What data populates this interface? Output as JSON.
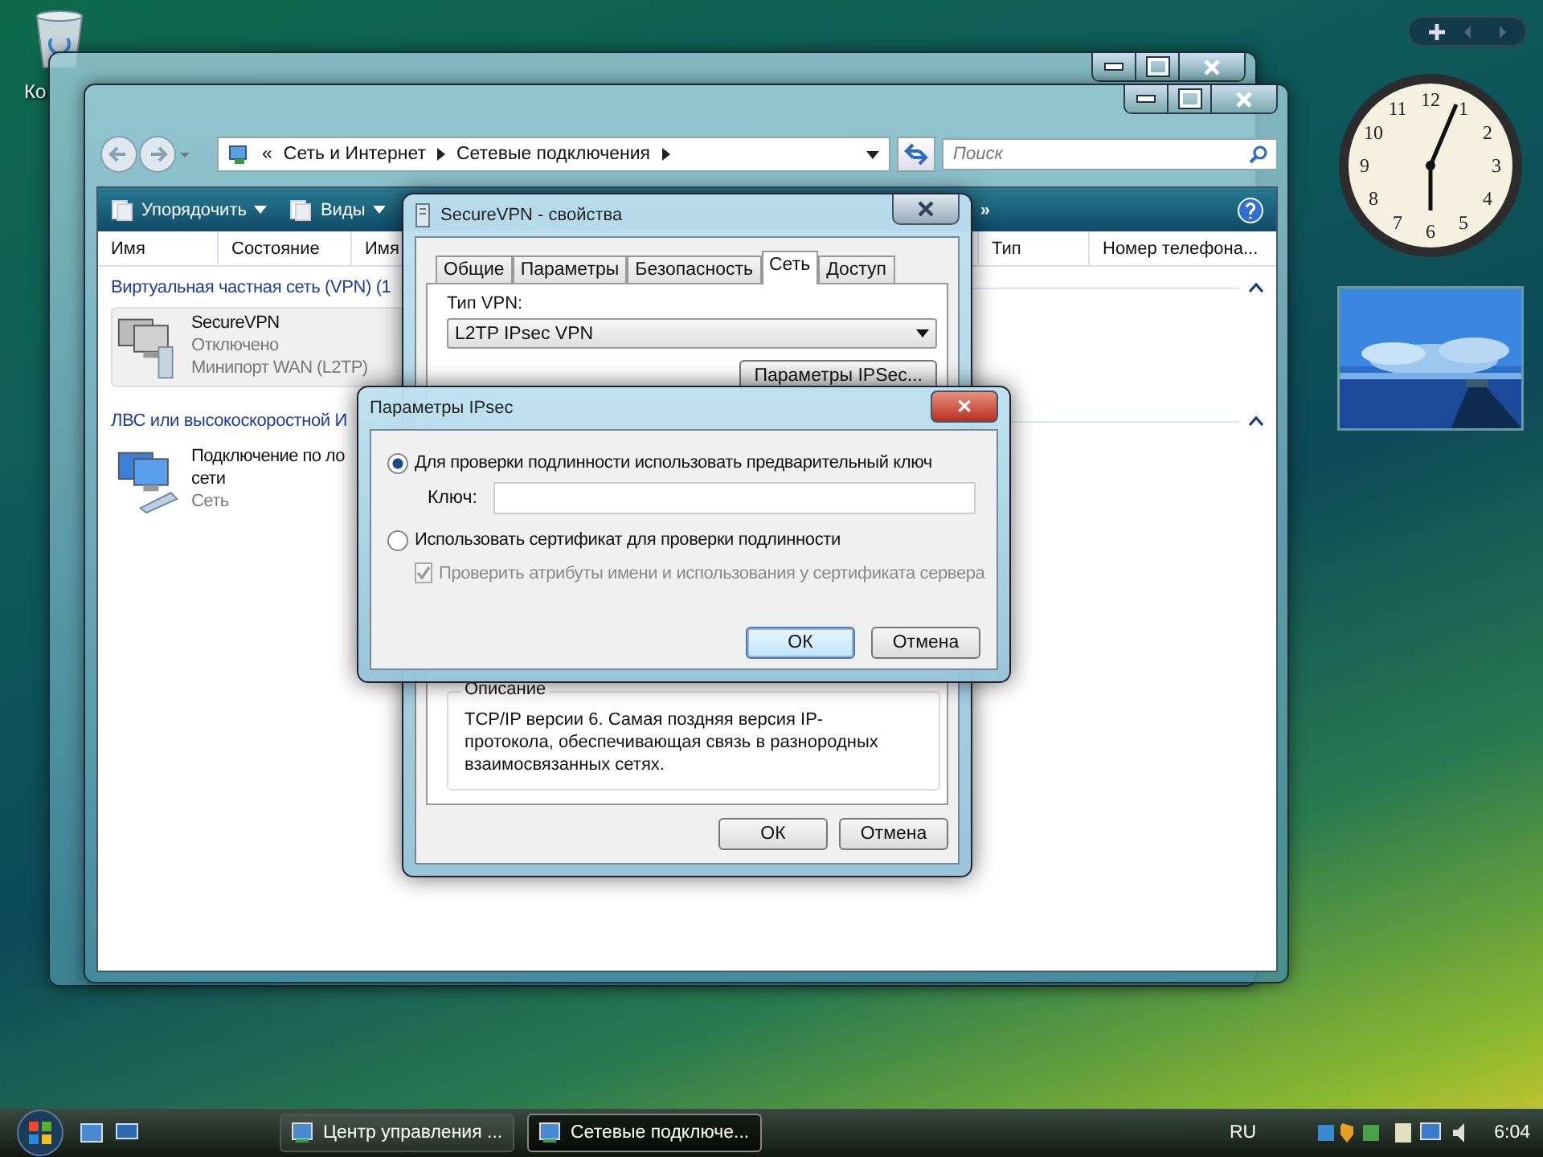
{
  "desktop": {
    "icons": [
      {
        "label": "Ко"
      }
    ]
  },
  "explorer": {
    "breadcrumb": [
      "«",
      "Сеть и Интернет",
      "Сетевые подключения"
    ],
    "search": {
      "placeholder": "Поиск"
    },
    "toolbar": [
      {
        "label": "Упорядочить"
      },
      {
        "label": "Виды"
      }
    ],
    "toolbar_overflow": "»",
    "columns_left": [
      "Имя",
      "Состояние",
      "Имя"
    ],
    "columns_right": [
      "Тип",
      "Номер телефона..."
    ],
    "groups": [
      {
        "title": "Виртуальная частная сеть (VPN) (1",
        "items": [
          {
            "lines": [
              "SecureVPN",
              "Отключено",
              "Минипорт WAN (L2TP)"
            ],
            "connected": false,
            "selected": true
          }
        ]
      },
      {
        "title": "ЛВС или высокоскоростной И",
        "items": [
          {
            "lines": [
              "Подключение по ло",
              "сети",
              "Сеть"
            ],
            "connected": true,
            "selected": false
          }
        ]
      }
    ]
  },
  "properties_dialog": {
    "title": "SecureVPN - свойства",
    "tabs": [
      {
        "label": "Общие",
        "selected": false
      },
      {
        "label": "Параметры",
        "selected": false
      },
      {
        "label": "Безопасность",
        "selected": false
      },
      {
        "label": "Сеть",
        "selected": true
      },
      {
        "label": "Доступ",
        "selected": false
      }
    ],
    "vpn_type_label": "Тип VPN:",
    "vpn_type_value": "L2TP IPsec VPN",
    "ipsec_button": "Параметры IPSec...",
    "description_label": "Описание",
    "description": "TCP/IP версии 6. Самая поздняя версия IP-протокола, обеспечивающая связь в разнородных взаимосвязанных сетях.",
    "buttons": [
      "ОК",
      "Отмена"
    ]
  },
  "ipsec_dialog": {
    "title": "Параметры IPsec",
    "close": "✕",
    "options": [
      {
        "label": "Для проверки подлинности использовать предварительный ключ",
        "selected": true
      },
      {
        "label": "Использовать сертификат для проверки подлинности",
        "selected": false
      }
    ],
    "key_label": "Ключ:",
    "verify": {
      "label": "Проверить атрибуты имени и использования у сертификата сервера",
      "checked": true,
      "disabled": true
    },
    "buttons": [
      "ОК",
      "Отмена"
    ]
  },
  "clock": {
    "numbers": [
      "12",
      "11",
      "1",
      "10",
      "2",
      "9",
      "3",
      "8",
      "4",
      "7",
      "5",
      "6"
    ]
  },
  "taskbar": {
    "tasks": [
      {
        "label": "Центр управления ...",
        "selected": false
      },
      {
        "label": "Сетевые подключе...",
        "selected": true
      }
    ],
    "language": "RU",
    "time": "6:04"
  }
}
